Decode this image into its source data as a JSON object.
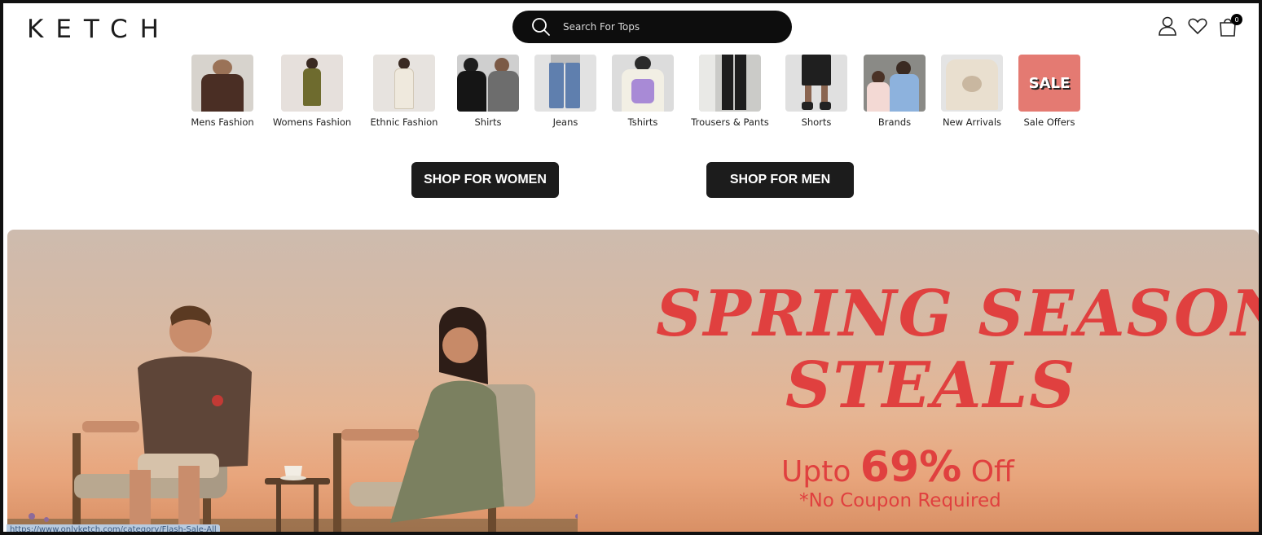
{
  "header": {
    "logo": "KETCH",
    "search_placeholder": "Search For Tops",
    "cart_count": "0"
  },
  "categories": [
    {
      "label": "Mens Fashion"
    },
    {
      "label": "Womens Fashion"
    },
    {
      "label": "Ethnic Fashion"
    },
    {
      "label": "Shirts"
    },
    {
      "label": "Jeans"
    },
    {
      "label": "Tshirts"
    },
    {
      "label": "Trousers & Pants"
    },
    {
      "label": "Shorts"
    },
    {
      "label": "Brands"
    },
    {
      "label": "New Arrivals"
    },
    {
      "label": "Sale Offers",
      "thumb_text": "SALE"
    }
  ],
  "shop_buttons": {
    "women": "SHOP FOR WOMEN",
    "men": "SHOP FOR MEN"
  },
  "banner": {
    "headline_line1": "SPRING SEASON",
    "headline_line2": "STEALS",
    "offer_prefix": "Upto ",
    "offer_value": "69%",
    "offer_suffix": " Off",
    "note": "*No Coupon Required"
  },
  "status_bar": {
    "url": "https://www.onlyketch.com/category/Flash-Sale-All"
  },
  "colors": {
    "accent_red": "#e0403f",
    "button_dark": "#1c1c1c",
    "search_bg": "#0d0d0d"
  }
}
